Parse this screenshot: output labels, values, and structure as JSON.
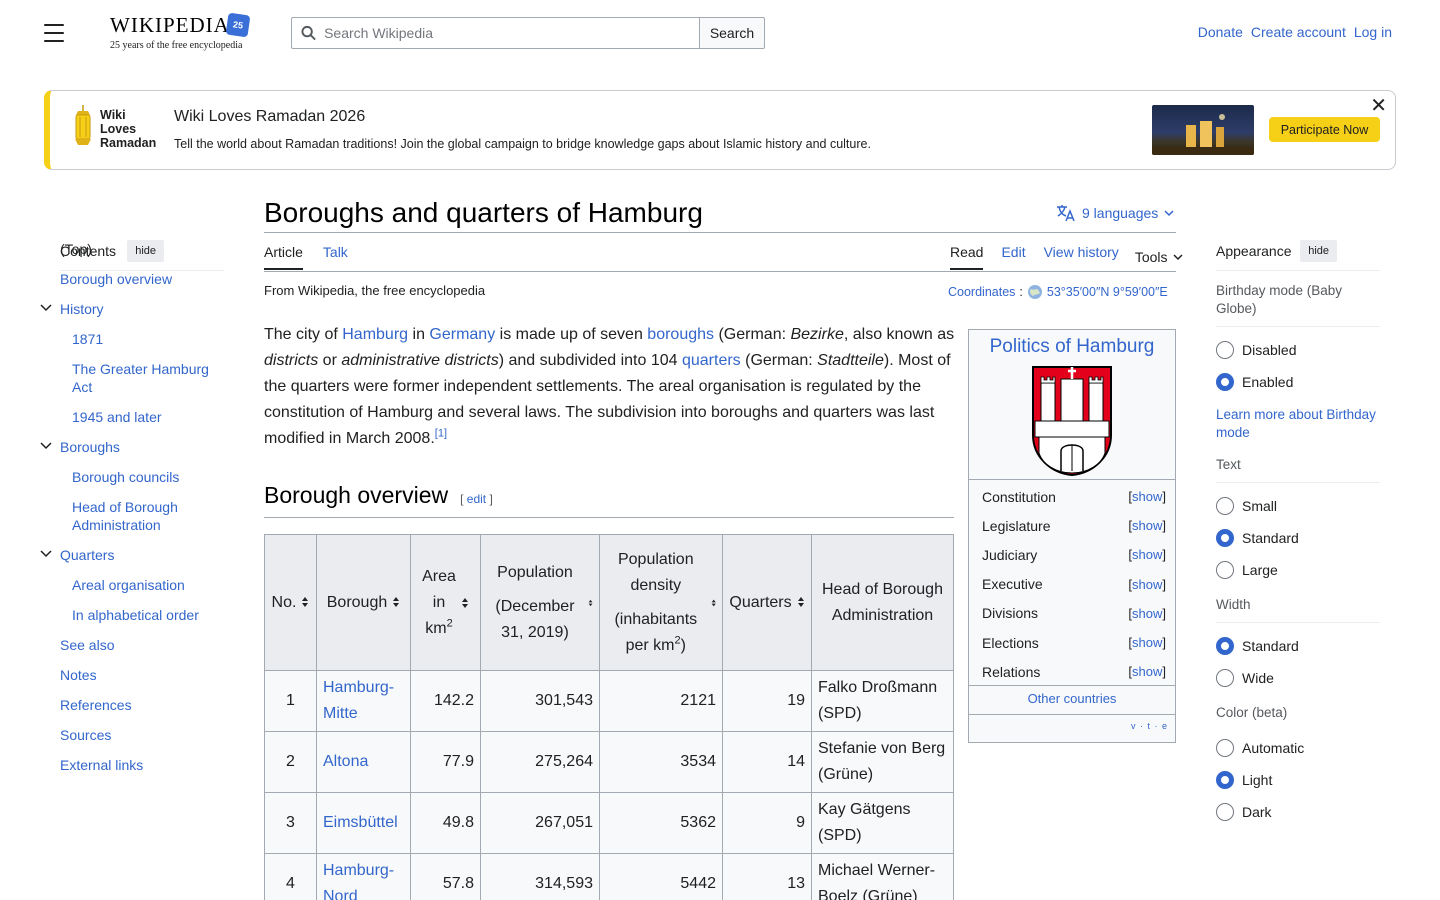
{
  "header": {
    "logo_word": "Wikipedia",
    "logo_badge": "25",
    "logo_tagline": "25 years of the free encyclopedia",
    "search_placeholder": "Search Wikipedia",
    "search_button": "Search",
    "donate": "Donate",
    "create_account": "Create account",
    "log_in": "Log in"
  },
  "banner": {
    "logo_text": [
      "Wiki",
      "Loves",
      "Ramadan"
    ],
    "title": "Wiki Loves Ramadan 2026",
    "text": "Tell the world about Ramadan traditions! Join the global campaign to bridge knowledge gaps about Islamic history and culture.",
    "button": "Participate Now",
    "accent": "#f5d016"
  },
  "toc": {
    "title": "Contents",
    "hide": "hide",
    "items": [
      {
        "label": "(Top)"
      },
      {
        "label": "Borough overview"
      },
      {
        "label": "History"
      },
      {
        "label": "1871"
      },
      {
        "label": "The Greater Hamburg Act"
      },
      {
        "label": "1945 and later"
      },
      {
        "label": "Boroughs"
      },
      {
        "label": "Borough councils"
      },
      {
        "label": "Head of Borough Administration"
      },
      {
        "label": "Quarters"
      },
      {
        "label": "Areal organisation"
      },
      {
        "label": "In alphabetical order"
      },
      {
        "label": "See also"
      },
      {
        "label": "Notes"
      },
      {
        "label": "References"
      },
      {
        "label": "Sources"
      },
      {
        "label": "External links"
      }
    ]
  },
  "article": {
    "title": "Boroughs and quarters of Hamburg",
    "languages": "9 languages",
    "tabs": {
      "article": "Article",
      "talk": "Talk",
      "read": "Read",
      "edit": "Edit",
      "history": "View history",
      "tools": "Tools"
    },
    "from": "From Wikipedia, the free encyclopedia",
    "coords_label": "Coordinates",
    "coords_value": "53°35′00″N 9°59′00″E",
    "intro": {
      "p1": "The city of ",
      "l_hamburg": "Hamburg",
      "p2": " in ",
      "l_germany": "Germany",
      "p3": " is made up of seven ",
      "l_boroughs": "boroughs",
      "p4": " (German: ",
      "i_bezirke": "Bezirke",
      "p5": ", also known as ",
      "i_districts": "districts",
      "p6": " or ",
      "i_admin": "administrative districts",
      "p7": ") and subdivided into 104 ",
      "l_quarters": "quarters",
      "p8": " (German: ",
      "i_stadtteile": "Stadtteile",
      "p9": "). Most of the quarters were former independent settlements. The areal organisation is regulated by the constitution of Hamburg and several laws. The subdivision into boroughs and quarters was last modified in March 2008.",
      "ref": "[1]"
    },
    "section_title": "Borough overview",
    "section_edit": "edit"
  },
  "table": {
    "headers": {
      "no": "No.",
      "borough": "Borough",
      "area_a": "Area",
      "area_b": "in",
      "area_c": "km",
      "pop_a": "Population",
      "pop_b": "(December 31, 2019)",
      "dens_a": "Population density",
      "dens_b": "(inhabitants per km",
      "quarters": "Quarters",
      "head": "Head of Borough Administration"
    },
    "rows": [
      {
        "no": "1",
        "borough": "Hamburg-Mitte",
        "area": "142.2",
        "pop": "301,543",
        "dens": "2121",
        "q": "19",
        "head": "Falko Droßmann (SPD)"
      },
      {
        "no": "2",
        "borough": "Altona",
        "area": "77.9",
        "pop": "275,264",
        "dens": "3534",
        "q": "14",
        "head": "Stefanie von Berg (Grüne)"
      },
      {
        "no": "3",
        "borough": "Eimsbüttel",
        "area": "49.8",
        "pop": "267,051",
        "dens": "5362",
        "q": "9",
        "head": "Kay Gätgens (SPD)"
      },
      {
        "no": "4",
        "borough": "Hamburg-Nord",
        "area": "57.8",
        "pop": "314,593",
        "dens": "5442",
        "q": "13",
        "head": "Michael Werner-Boelz (Grüne)"
      }
    ]
  },
  "infobox": {
    "title": "Politics of Hamburg",
    "rows": [
      {
        "label": "Constitution",
        "show": "show"
      },
      {
        "label": "Legislature",
        "show": "show"
      },
      {
        "label": "Judiciary",
        "show": "show"
      },
      {
        "label": "Executive",
        "show": "show"
      },
      {
        "label": "Divisions",
        "show": "show"
      },
      {
        "label": "Elections",
        "show": "show"
      },
      {
        "label": "Relations",
        "show": "show"
      }
    ],
    "other": "Other countries",
    "vte": "v · t · e",
    "coat_red": "#e2001a"
  },
  "appearance": {
    "title": "Appearance",
    "hide": "hide",
    "birthday_label": "Birthday mode (Baby Globe)",
    "birthday_opts": [
      "Disabled",
      "Enabled"
    ],
    "birthday_link": "Learn more about Birthday mode",
    "text_label": "Text",
    "text_opts": [
      "Small",
      "Standard",
      "Large"
    ],
    "width_label": "Width",
    "width_opts": [
      "Standard",
      "Wide"
    ],
    "color_label": "Color (beta)",
    "color_opts": [
      "Automatic",
      "Light",
      "Dark"
    ],
    "accent": "#3366cc"
  }
}
